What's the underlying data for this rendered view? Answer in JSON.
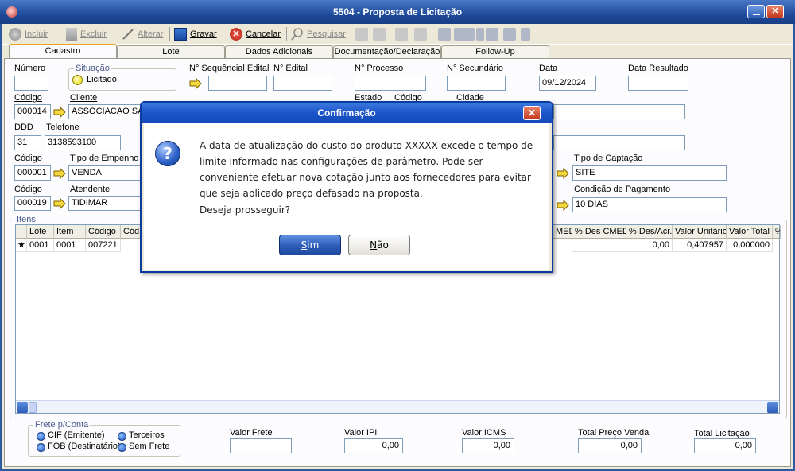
{
  "window": {
    "title": "5504 - Proposta de Licitação"
  },
  "toolbar": {
    "incluir": "Incluir",
    "excluir": "Excluir",
    "alterar": "Alterar",
    "gravar": "Gravar",
    "cancelar": "Cancelar",
    "pesquisar": "Pesquisar"
  },
  "tabs": [
    "Cadastro",
    "Lote",
    "Dados Adicionais",
    "Documentação/Declaração",
    "Follow-Up"
  ],
  "form": {
    "numero_label": "Número",
    "numero": "",
    "situacao_label": "Situação",
    "situacao": "Licitado",
    "seq_edital_label": "N° Sequêncial Edital",
    "seq_edital": "",
    "edital_label": "N° Edital",
    "edital": "",
    "processo_label": "N° Processo",
    "processo": "",
    "secundario_label": "N° Secundário",
    "secundario": "",
    "data_label": "Data",
    "data": "09/12/2024",
    "data_resultado_label": "Data Resultado",
    "data_resultado": "",
    "codigo_label": "Código",
    "cliente_label": "Cliente",
    "cliente_codigo": "000014",
    "cliente_nome": "ASSOCIACAO SAI",
    "estado_label": "Estado",
    "codigo2_label": "Código",
    "cidade_label": "Cidade",
    "ddd_label": "DDD",
    "ddd": "31",
    "telefone_label": "Telefone",
    "telefone": "3138593100",
    "codigo3_label": "Código",
    "tipo_empenho_label": "Tipo de Empenho",
    "empenho_codigo": "000001",
    "empenho": "VENDA",
    "tipo_captacao_label": "Tipo de Captação",
    "captacao": "SITE",
    "codigo4_label": "Código",
    "atendente_label": "Atendente",
    "atendente_codigo": "000019",
    "atendente": "TIDIMAR",
    "cond_pagamento_label": "Condição de Pagamento",
    "cond_pagamento": "10 DIAS"
  },
  "itens": {
    "title": "Itens",
    "columns_left": [
      "Lote",
      "Item",
      "Código",
      "Cód"
    ],
    "columns_right": [
      "MED",
      "% Des CMED",
      "% Des/Acr.",
      "Valor Unitário",
      "Valor Total",
      "%"
    ],
    "row": {
      "marker": "★",
      "lote": "0001",
      "item": "0001",
      "codigo": "007221",
      "des_acr": "0,00",
      "valor_unitario": "0,407957",
      "valor_total": "0,000000"
    }
  },
  "footer": {
    "frete_title": "Frete p/Conta",
    "cif": "CIF (Emitente)",
    "terceiros": "Terceiros",
    "fob": "FOB (Destinatário)",
    "sem_frete": "Sem Frete",
    "valor_frete_label": "Valor Frete",
    "valor_frete": "",
    "valor_ipi_label": "Valor IPI",
    "valor_ipi": "0,00",
    "valor_icms_label": "Valor ICMS",
    "valor_icms": "0,00",
    "total_preco_label": "Total Preço Venda",
    "total_preco": "0,00",
    "total_licitacao_label": "Total Licitação",
    "total_licitacao": "0,00"
  },
  "dialog": {
    "title": "Confirmação",
    "message": "A data de atualização do custo do produto XXXXX excede o tempo de limite informado nas configurações de parâmetro. Pode ser conveniente efetuar nova cotação junto aos fornecedores para evitar que seja aplicado preço defasado na proposta.",
    "question": "Deseja prosseguir?",
    "yes_ul": "S",
    "yes_rest": "im",
    "no_ul": "N",
    "no_rest": "ão"
  }
}
